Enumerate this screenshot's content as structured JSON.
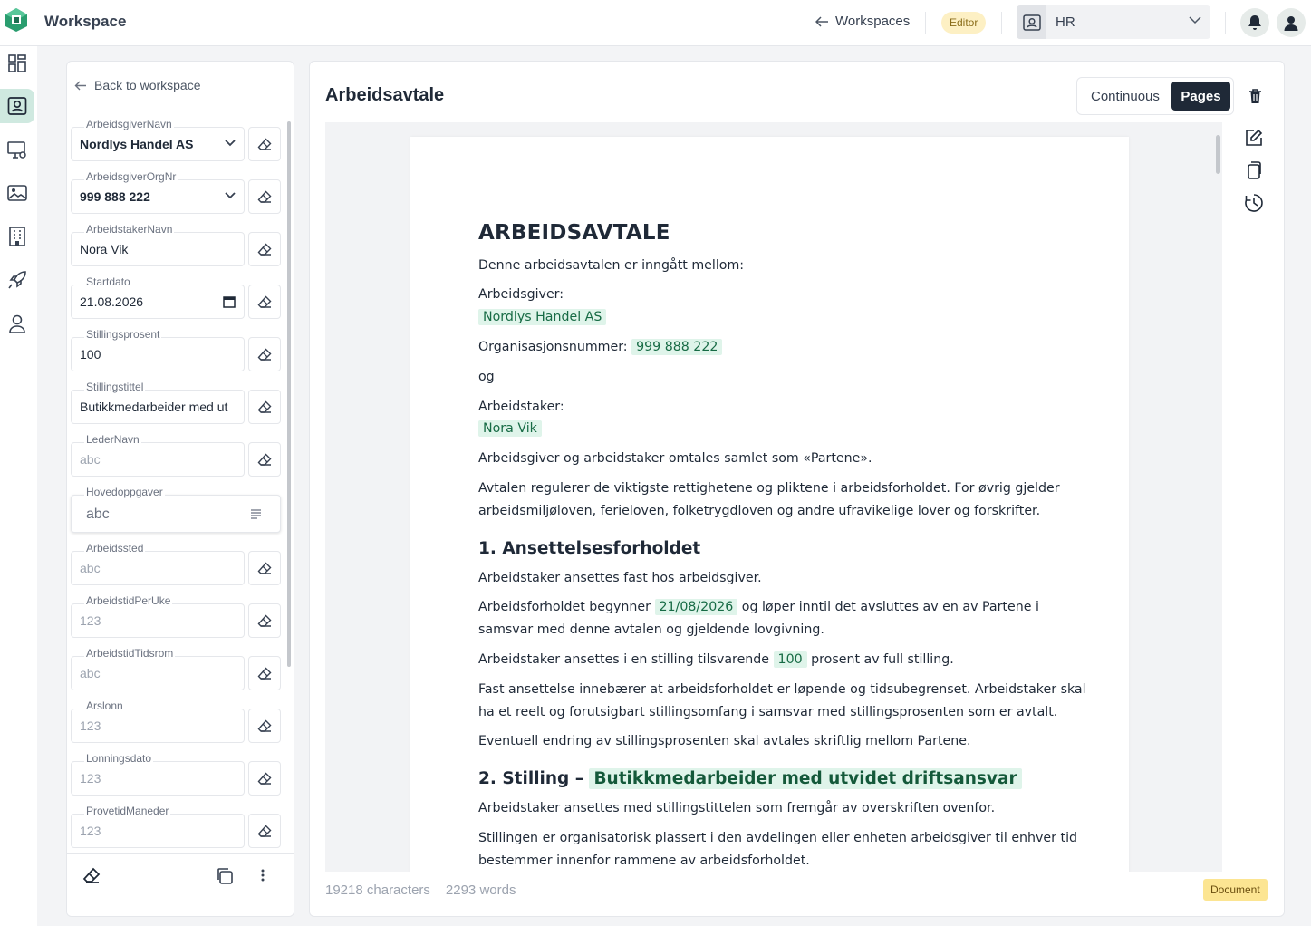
{
  "app": {
    "title": "Workspace"
  },
  "topbar": {
    "workspaces_label": "Workspaces",
    "role_badge": "Editor",
    "team_select": "HR"
  },
  "form": {
    "back_label": "Back to workspace",
    "fields": [
      {
        "label": "ArbeidsgiverNavn",
        "value": "Nordlys Handel AS"
      },
      {
        "label": "ArbeidsgiverOrgNr",
        "value": "999 888 222"
      },
      {
        "label": "ArbeidstakerNavn",
        "value": "Nora Vik"
      },
      {
        "label": "Startdato",
        "value": "21.08.2026"
      },
      {
        "label": "Stillingsprosent",
        "value": "100"
      },
      {
        "label": "Stillingstittel",
        "value": "Butikkmedarbeider med ut"
      },
      {
        "label": "LederNavn",
        "placeholder": "abc"
      },
      {
        "label": "Hovedoppgaver",
        "placeholder": "abc"
      },
      {
        "label": "Arbeidssted",
        "placeholder": "abc"
      },
      {
        "label": "ArbeidstidPerUke",
        "placeholder": "123"
      },
      {
        "label": "ArbeidstidTidsrom",
        "placeholder": "abc"
      },
      {
        "label": "Arslonn",
        "placeholder": "123"
      },
      {
        "label": "Lonningsdato",
        "placeholder": "123"
      },
      {
        "label": "ProvetidManeder",
        "placeholder": "123"
      }
    ]
  },
  "document": {
    "title": "Arbeidsavtale",
    "view_continuous": "Continuous",
    "view_pages": "Pages",
    "heading": "ARBEIDSAVTALE",
    "intro": "Denne arbeidsavtalen er inngått mellom:",
    "employer_label": "Arbeidsgiver:",
    "employer_name": "Nordlys Handel AS",
    "orgnr_label": "Organisasjonsnummer:",
    "orgnr_value": "999 888 222",
    "and": "og",
    "employee_label": "Arbeidstaker:",
    "employee_name": "Nora Vik",
    "parties": "Arbeidsgiver og arbeidstaker omtales samlet som «Partene».",
    "regulates_1": "Avtalen regulerer de viktigste rettighetene og pliktene i arbeidsforholdet. For øvrig gjelder",
    "regulates_2": "arbeidsmiljøloven, ferieloven, folketrygdloven og andre ufravikelige lover og forskrifter.",
    "s1_title": "1. Ansettelsesforholdet",
    "s1_p1": "Arbeidstaker ansettes fast hos arbeidsgiver.",
    "s1_p2_a": "Arbeidsforholdet begynner",
    "s1_p2_date": "21/08/2026",
    "s1_p2_b": "og løper inntil det avsluttes av en av Partene i",
    "s1_p2_c": "samsvar med denne avtalen og gjeldende lovgivning.",
    "s1_p3_a": "Arbeidstaker ansettes i en stilling tilsvarende",
    "s1_p3_pct": "100",
    "s1_p3_b": "prosent av full stilling.",
    "s1_p4_a": "Fast ansettelse innebærer at arbeidsforholdet er løpende og tidsubegrenset. Arbeidstaker skal",
    "s1_p4_b": "ha et reelt og forutsigbart stillingsomfang i samsvar med stillingsprosenten som er avtalt.",
    "s1_p5": "Eventuell endring av stillingsprosenten skal avtales skriftlig mellom Partene.",
    "s2_title_a": "2. Stilling –",
    "s2_title_b": "Butikkmedarbeider med utvidet driftsansvar",
    "s2_p1": "Arbeidstaker ansettes med stillingstittelen som fremgår av overskriften ovenfor.",
    "s2_p2_a": "Stillingen er organisatorisk plassert i den avdelingen eller enheten arbeidsgiver til enhver tid",
    "s2_p2_b": "bestemmer innenfor rammene av arbeidsforholdet.",
    "char_count": "19218 characters",
    "word_count": "2293 words",
    "type_badge": "Document"
  },
  "colors": {
    "accent": "#1f8a60",
    "highlight_bg": "#dff4ea",
    "highlight_text": "#176b45",
    "dark_button": "#1f2937",
    "editor_badge": "#fdf0c4",
    "document_badge": "#fce592"
  },
  "icons": {
    "rail": [
      "dashboard-icon",
      "contact-card-icon",
      "monitor-settings-icon",
      "image-icon",
      "building-icon",
      "rocket-icon",
      "user-icon"
    ],
    "tools": [
      "trash-icon",
      "edit-icon",
      "copy-icon",
      "history-icon"
    ]
  }
}
